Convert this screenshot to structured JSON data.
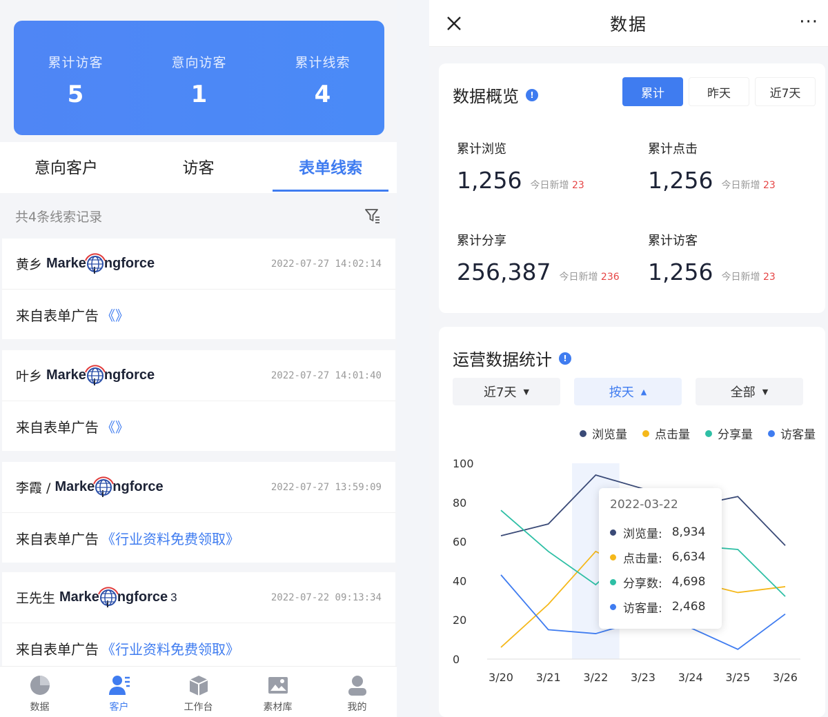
{
  "left": {
    "stats": [
      {
        "label": "累计访客",
        "value": "5"
      },
      {
        "label": "意向访客",
        "value": "1"
      },
      {
        "label": "累计线索",
        "value": "4"
      }
    ],
    "tabs": [
      "意向客户",
      "访客",
      "表单线索"
    ],
    "active_tab": 2,
    "record_count": "共4条线索记录",
    "brand": {
      "pre": "Marke",
      "post": "ngforce"
    },
    "leads": [
      {
        "name": "黄乡",
        "suffix": "",
        "time": "2022-07-27 14:02:14",
        "source": "来自表单广告",
        "quote": "《》"
      },
      {
        "name": "叶乡",
        "suffix": "",
        "time": "2022-07-27 14:01:40",
        "source": "来自表单广告",
        "quote": "《》"
      },
      {
        "name": "李霞 /",
        "suffix": "",
        "time": "2022-07-27 13:59:09",
        "source": "来自表单广告",
        "quote": "《行业资料免费领取》"
      },
      {
        "name": "王先生",
        "suffix": "3",
        "time": "2022-07-22 09:13:34",
        "source": "来自表单广告",
        "quote": "《行业资料免费领取》"
      }
    ],
    "nav": [
      {
        "label": "数据",
        "icon": "pie-chart-icon"
      },
      {
        "label": "客户",
        "icon": "users-icon"
      },
      {
        "label": "工作台",
        "icon": "box-icon"
      },
      {
        "label": "素材库",
        "icon": "image-icon"
      },
      {
        "label": "我的",
        "icon": "user-icon"
      }
    ],
    "active_nav": 1
  },
  "right": {
    "header": {
      "title": "数据",
      "more": "···"
    },
    "overview": {
      "title": "数据概览",
      "periods": [
        "累计",
        "昨天",
        "近7天"
      ],
      "active_period": 0,
      "inc_label": "今日新增",
      "metrics": [
        {
          "label": "累计浏览",
          "value": "1,256",
          "inc": "23"
        },
        {
          "label": "累计点击",
          "value": "1,256",
          "inc": "23"
        },
        {
          "label": "累计分享",
          "value": "256,387",
          "inc": "236"
        },
        {
          "label": "累计访客",
          "value": "1,256",
          "inc": "23"
        }
      ]
    },
    "stats": {
      "title": "运营数据统计",
      "dropdowns": [
        "近7天",
        "按天",
        "全部"
      ],
      "active_dropdown": 1,
      "tooltip": {
        "date": "2022-03-22",
        "rows": [
          {
            "label": "浏览量:",
            "value": "8,934",
            "color": "#3a4a77"
          },
          {
            "label": "点击量:",
            "value": "6,634",
            "color": "#f5b81a"
          },
          {
            "label": "分享数:",
            "value": "4,698",
            "color": "#2ebfa5"
          },
          {
            "label": "访客量:",
            "value": "2,468",
            "color": "#3f7cf0"
          }
        ]
      }
    }
  },
  "chart_data": {
    "type": "line",
    "categories": [
      "3/20",
      "3/21",
      "3/22",
      "3/23",
      "3/24",
      "3/25",
      "3/26"
    ],
    "ylim": [
      0,
      100
    ],
    "yticks": [
      0,
      20,
      40,
      60,
      80,
      100
    ],
    "highlight_index": 2,
    "series": [
      {
        "name": "浏览量",
        "color": "#3a4a77",
        "values": [
          63,
          69,
          94,
          87,
          78,
          83,
          58
        ]
      },
      {
        "name": "点击量",
        "color": "#f5b81a",
        "values": [
          6,
          28,
          55,
          43,
          40,
          34,
          37
        ]
      },
      {
        "name": "分享量",
        "color": "#2ebfa5",
        "values": [
          76,
          55,
          38,
          60,
          58,
          56,
          32
        ]
      },
      {
        "name": "访客量",
        "color": "#3f7cf0",
        "values": [
          43,
          15,
          13,
          20,
          16,
          5,
          23
        ]
      }
    ]
  }
}
